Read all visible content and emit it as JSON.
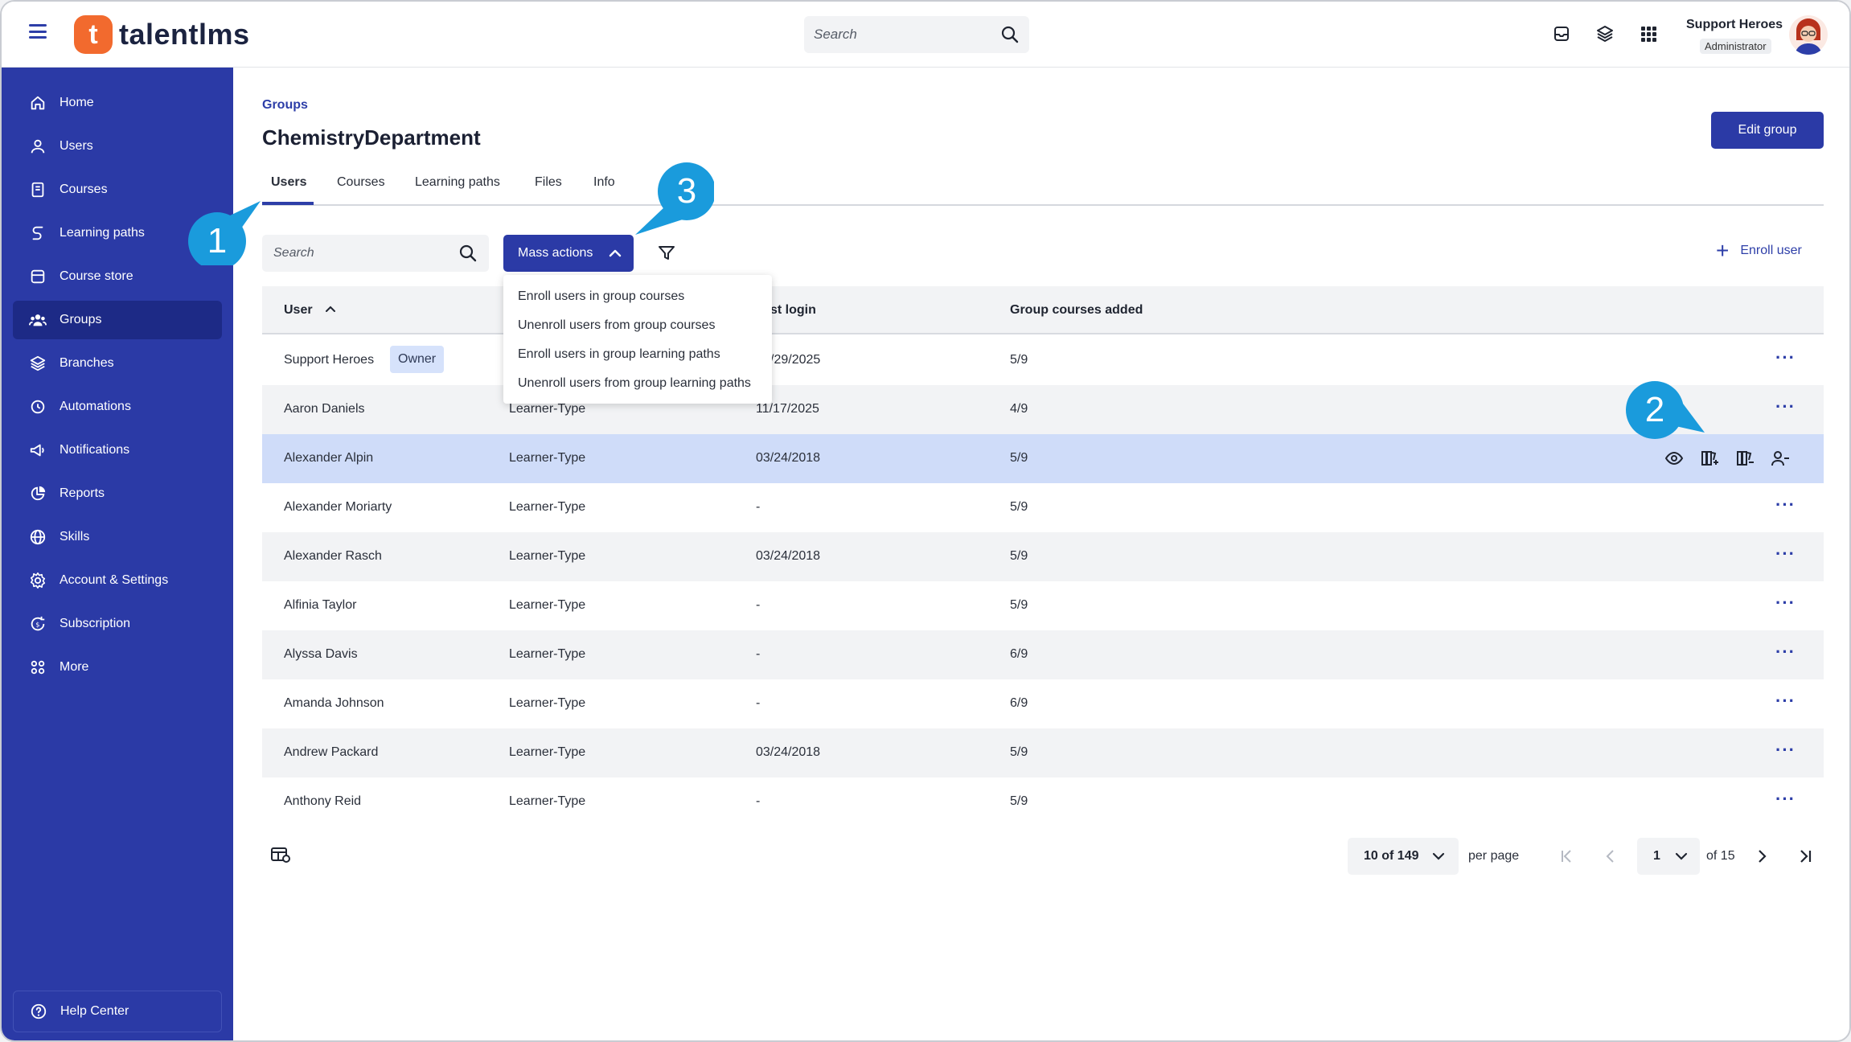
{
  "app": {
    "logo_text": "talentlms",
    "logo_letter": "t"
  },
  "topbar": {
    "search_placeholder": "Search",
    "user_name": "Support Heroes",
    "user_role": "Administrator"
  },
  "sidebar": {
    "items": [
      {
        "label": "Home",
        "icon": "home-icon"
      },
      {
        "label": "Users",
        "icon": "user-icon"
      },
      {
        "label": "Courses",
        "icon": "book-icon"
      },
      {
        "label": "Learning paths",
        "icon": "path-icon"
      },
      {
        "label": "Course store",
        "icon": "store-icon"
      },
      {
        "label": "Groups",
        "icon": "groups-icon",
        "active": true
      },
      {
        "label": "Branches",
        "icon": "layers-icon"
      },
      {
        "label": "Automations",
        "icon": "automation-icon"
      },
      {
        "label": "Notifications",
        "icon": "megaphone-icon"
      },
      {
        "label": "Reports",
        "icon": "pie-icon"
      },
      {
        "label": "Skills",
        "icon": "globe-icon"
      },
      {
        "label": "Account & Settings",
        "icon": "gear-icon"
      },
      {
        "label": "Subscription",
        "icon": "subscription-icon"
      },
      {
        "label": "More",
        "icon": "grid-icon"
      }
    ],
    "help_label": "Help Center"
  },
  "main": {
    "breadcrumb": "Groups",
    "title": "ChemistryDepartment",
    "edit_button": "Edit group",
    "tabs": [
      "Users",
      "Courses",
      "Learning paths",
      "Files",
      "Info"
    ],
    "active_tab": "Users",
    "search_placeholder": "Search",
    "mass_actions_label": "Mass actions",
    "enroll_user_label": "Enroll user",
    "mass_actions_menu": [
      "Enroll users in group courses",
      "Unenroll users from group courses",
      "Enroll users in group learning paths",
      "Unenroll users from group learning paths"
    ]
  },
  "table": {
    "headers": {
      "user": "User",
      "last_login": "st login",
      "group_courses": "Group courses added"
    },
    "rows": [
      {
        "user": "Support Heroes",
        "badge": "Owner",
        "type": "",
        "last_login": "/29/2025",
        "courses": "5/9"
      },
      {
        "user": "Aaron Daniels",
        "type": "Learner-Type",
        "last_login": "11/17/2025",
        "courses": "4/9"
      },
      {
        "user": "Alexander Alpin",
        "type": "Learner-Type",
        "last_login": "03/24/2018",
        "courses": "5/9",
        "highlighted": true
      },
      {
        "user": "Alexander Moriarty",
        "type": "Learner-Type",
        "last_login": "-",
        "courses": "5/9"
      },
      {
        "user": "Alexander Rasch",
        "type": "Learner-Type",
        "last_login": "03/24/2018",
        "courses": "5/9"
      },
      {
        "user": "Alfinia Taylor",
        "type": "Learner-Type",
        "last_login": "-",
        "courses": "5/9"
      },
      {
        "user": "Alyssa Davis",
        "type": "Learner-Type",
        "last_login": "-",
        "courses": "6/9"
      },
      {
        "user": "Amanda Johnson",
        "type": "Learner-Type",
        "last_login": "-",
        "courses": "6/9"
      },
      {
        "user": "Andrew Packard",
        "type": "Learner-Type",
        "last_login": "03/24/2018",
        "courses": "5/9"
      },
      {
        "user": "Anthony Reid",
        "type": "Learner-Type",
        "last_login": "-",
        "courses": "5/9"
      }
    ],
    "row_action_icons": [
      "eye-icon",
      "add-course-icon",
      "remove-course-icon",
      "remove-user-icon"
    ],
    "more_label": "···"
  },
  "pagination": {
    "per_page_value": "10 of 149",
    "per_page_label": "per page",
    "page_value": "1",
    "of_pages": "of 15"
  },
  "callouts": [
    "1",
    "2",
    "3"
  ],
  "colors": {
    "sidebar": "#2b3aa6",
    "accent": "#2d3ea8",
    "callout": "#1a9bdc",
    "logo": "#f26a2e",
    "highlight_row": "#cfdcf9"
  }
}
